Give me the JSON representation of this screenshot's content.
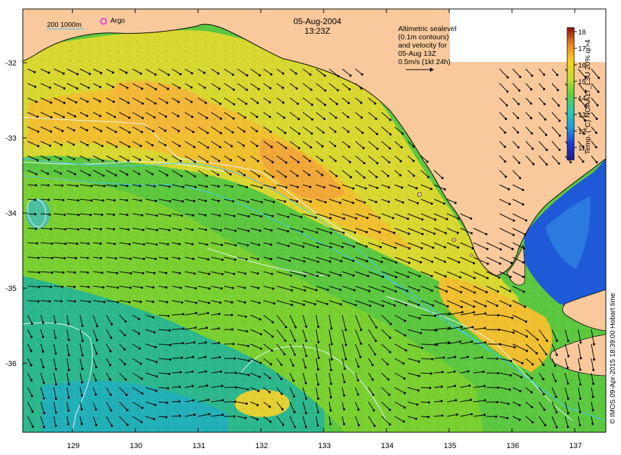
{
  "header": {
    "date": "05-Aug-2004",
    "time": "13:23Z"
  },
  "topleft_legend": {
    "depth_label": "200  1000m",
    "argo_label": "Argo"
  },
  "altimetry_note": {
    "line1": "Altimetric sealevel",
    "line2": "(0.1m contours)",
    "line3": "and velocity for",
    "line4": "05-Aug 13Z",
    "line5": "0.5m/s (1kt 24h)"
  },
  "colorbar": {
    "title": "Temp. (°C) NOAA17_L3U 20% qi>4",
    "ticks": [
      "18",
      "17",
      "16",
      "15",
      "14",
      "13",
      "12",
      "11"
    ],
    "min": 10.5,
    "max": 18.5
  },
  "credit": "© IMOS 09-Apr-2015 18:39:00 Hobart time",
  "axes": {
    "lat_ticks": [
      "-32",
      "-33",
      "-34",
      "-35",
      "-36"
    ],
    "lon_ticks": [
      "129",
      "130",
      "131",
      "132",
      "133",
      "134",
      "135",
      "136",
      "137"
    ],
    "lat_range": [
      -36.9,
      -31.35
    ],
    "lon_range": [
      128.2,
      137.55
    ]
  },
  "colors": {
    "land": "#f9c99c",
    "warm_sst": "#f0c030",
    "mid_sst": "#7cd030",
    "cool_sst": "#30b8a0",
    "gulf_sst": "#1e5ad8",
    "argo_marker": "#e020e0",
    "contour": "#e8f4ff",
    "isobath": "#40c8ff"
  }
}
